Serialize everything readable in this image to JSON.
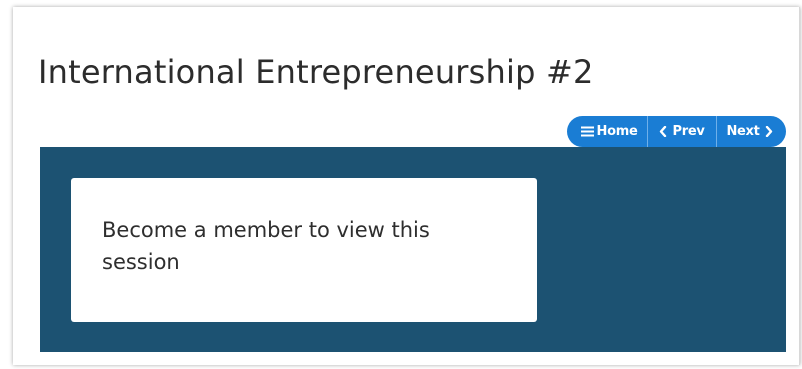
{
  "page": {
    "title": "International Entrepreneurship #2"
  },
  "nav": {
    "home": {
      "label": "Home",
      "icon": "menu-icon"
    },
    "prev": {
      "label": "Prev",
      "icon": "chevron-left-icon"
    },
    "next": {
      "label": "Next",
      "icon": "chevron-right-icon"
    }
  },
  "session": {
    "message": "Become a member to view this session"
  },
  "colors": {
    "accent": "#1a7dd4",
    "panel": "#1c5272",
    "card": "#ffffff",
    "title_text": "#2c2c2c"
  }
}
